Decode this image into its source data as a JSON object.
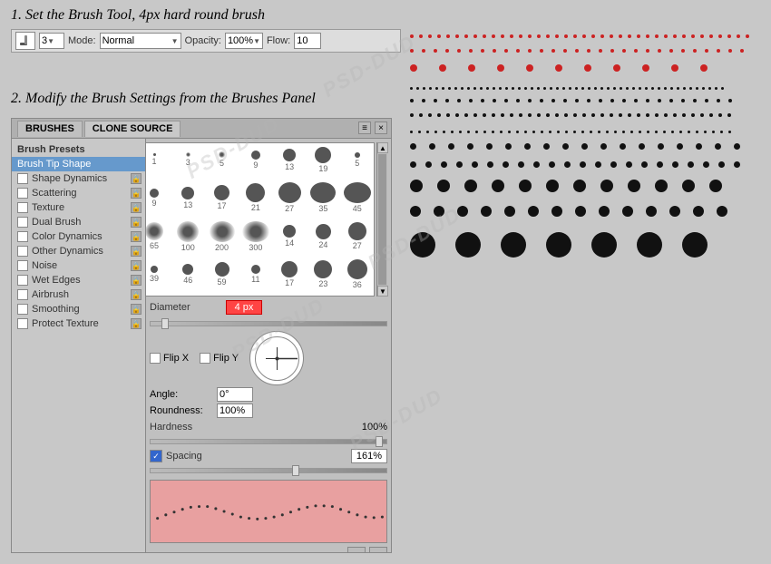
{
  "instructions": {
    "step1": "1. Set the Brush Tool, 4px hard round brush",
    "step2": "2. Modify the Brush Settings from the Brushes Panel"
  },
  "toolbar": {
    "brush_label": "Brush:",
    "brush_size": "3",
    "mode_label": "Mode:",
    "mode_value": "Normal",
    "opacity_label": "Opacity:",
    "opacity_value": "100%",
    "flow_label": "Flow:",
    "flow_value": "10"
  },
  "panel": {
    "title_brushes": "BRUSHES",
    "title_clone": "CLONE SOURCE",
    "close_label": "×",
    "menu_label": "≡"
  },
  "sidebar": {
    "presets_label": "Brush Presets",
    "items": [
      {
        "id": "brush-tip-shape",
        "label": "Brush Tip Shape",
        "active": true,
        "has_lock": false
      },
      {
        "id": "shape-dynamics",
        "label": "Shape Dynamics",
        "active": false,
        "has_lock": true
      },
      {
        "id": "scattering",
        "label": "Scattering",
        "active": false,
        "has_lock": true
      },
      {
        "id": "texture",
        "label": "Texture",
        "active": false,
        "has_lock": true
      },
      {
        "id": "dual-brush",
        "label": "Dual Brush",
        "active": false,
        "has_lock": true
      },
      {
        "id": "color-dynamics",
        "label": "Color Dynamics",
        "active": false,
        "has_lock": true
      },
      {
        "id": "other-dynamics",
        "label": "Other Dynamics",
        "active": false,
        "has_lock": true
      },
      {
        "id": "noise",
        "label": "Noise",
        "active": false,
        "has_lock": true
      },
      {
        "id": "wet-edges",
        "label": "Wet Edges",
        "active": false,
        "has_lock": true
      },
      {
        "id": "airbrush",
        "label": "Airbrush",
        "active": false,
        "has_lock": true
      },
      {
        "id": "smoothing",
        "label": "Smoothing",
        "active": false,
        "has_lock": true
      },
      {
        "id": "protect-texture",
        "label": "Protect Texture",
        "active": false,
        "has_lock": true
      }
    ]
  },
  "brush_grid": {
    "brushes": [
      {
        "size": 4,
        "num": "1",
        "soft": false
      },
      {
        "size": 6,
        "num": "3",
        "soft": true
      },
      {
        "size": 8,
        "num": "5",
        "soft": true
      },
      {
        "size": 12,
        "num": "9",
        "soft": false
      },
      {
        "size": 16,
        "num": "13",
        "soft": false
      },
      {
        "size": 22,
        "num": "19",
        "soft": false
      },
      {
        "size": 8,
        "num": "5",
        "soft": false
      },
      {
        "size": 12,
        "num": "9",
        "soft": false
      },
      {
        "size": 16,
        "num": "13",
        "soft": false
      },
      {
        "size": 20,
        "num": "17",
        "soft": false
      },
      {
        "size": 24,
        "num": "21",
        "soft": false
      },
      {
        "size": 28,
        "num": "27",
        "soft": false
      },
      {
        "size": 32,
        "num": "35",
        "soft": false
      },
      {
        "size": 36,
        "num": "45",
        "soft": false
      },
      {
        "size": 22,
        "num": "65",
        "soft": true
      },
      {
        "size": 26,
        "num": "100",
        "soft": true
      },
      {
        "size": 30,
        "num": "200",
        "soft": true
      },
      {
        "size": 32,
        "num": "300",
        "soft": true
      },
      {
        "size": 16,
        "num": "14",
        "soft": false
      },
      {
        "size": 18,
        "num": "24",
        "soft": false
      },
      {
        "size": 20,
        "num": "27",
        "soft": false
      }
    ]
  },
  "controls": {
    "diameter_label": "Diameter",
    "diameter_value": "4 px",
    "flip_x_label": "Flip X",
    "flip_y_label": "Flip Y",
    "angle_label": "Angle:",
    "angle_value": "0°",
    "roundness_label": "Roundness:",
    "roundness_value": "100%",
    "hardness_label": "Hardness",
    "hardness_value": "100%",
    "spacing_label": "Spacing",
    "spacing_value": "161%"
  },
  "dot_rows": [
    {
      "count": 30,
      "size": 4,
      "color": "red",
      "gap": 6
    },
    {
      "count": 28,
      "size": 4,
      "color": "red",
      "gap": 9
    },
    {
      "count": 12,
      "size": 8,
      "color": "red",
      "gap": 22
    },
    {
      "count": 35,
      "size": 3,
      "color": "black",
      "gap": 5
    },
    {
      "count": 20,
      "size": 4,
      "color": "black",
      "gap": 11
    },
    {
      "count": 25,
      "size": 4,
      "color": "black",
      "gap": 8
    },
    {
      "count": 30,
      "size": 3,
      "color": "black",
      "gap": 6
    },
    {
      "count": 15,
      "size": 6,
      "color": "black",
      "gap": 16
    },
    {
      "count": 20,
      "size": 6,
      "color": "black",
      "gap": 11
    },
    {
      "count": 10,
      "size": 12,
      "color": "black",
      "gap": 22
    },
    {
      "count": 14,
      "size": 10,
      "color": "black",
      "gap": 16
    },
    {
      "count": 8,
      "size": 22,
      "color": "black",
      "gap": 28
    }
  ]
}
